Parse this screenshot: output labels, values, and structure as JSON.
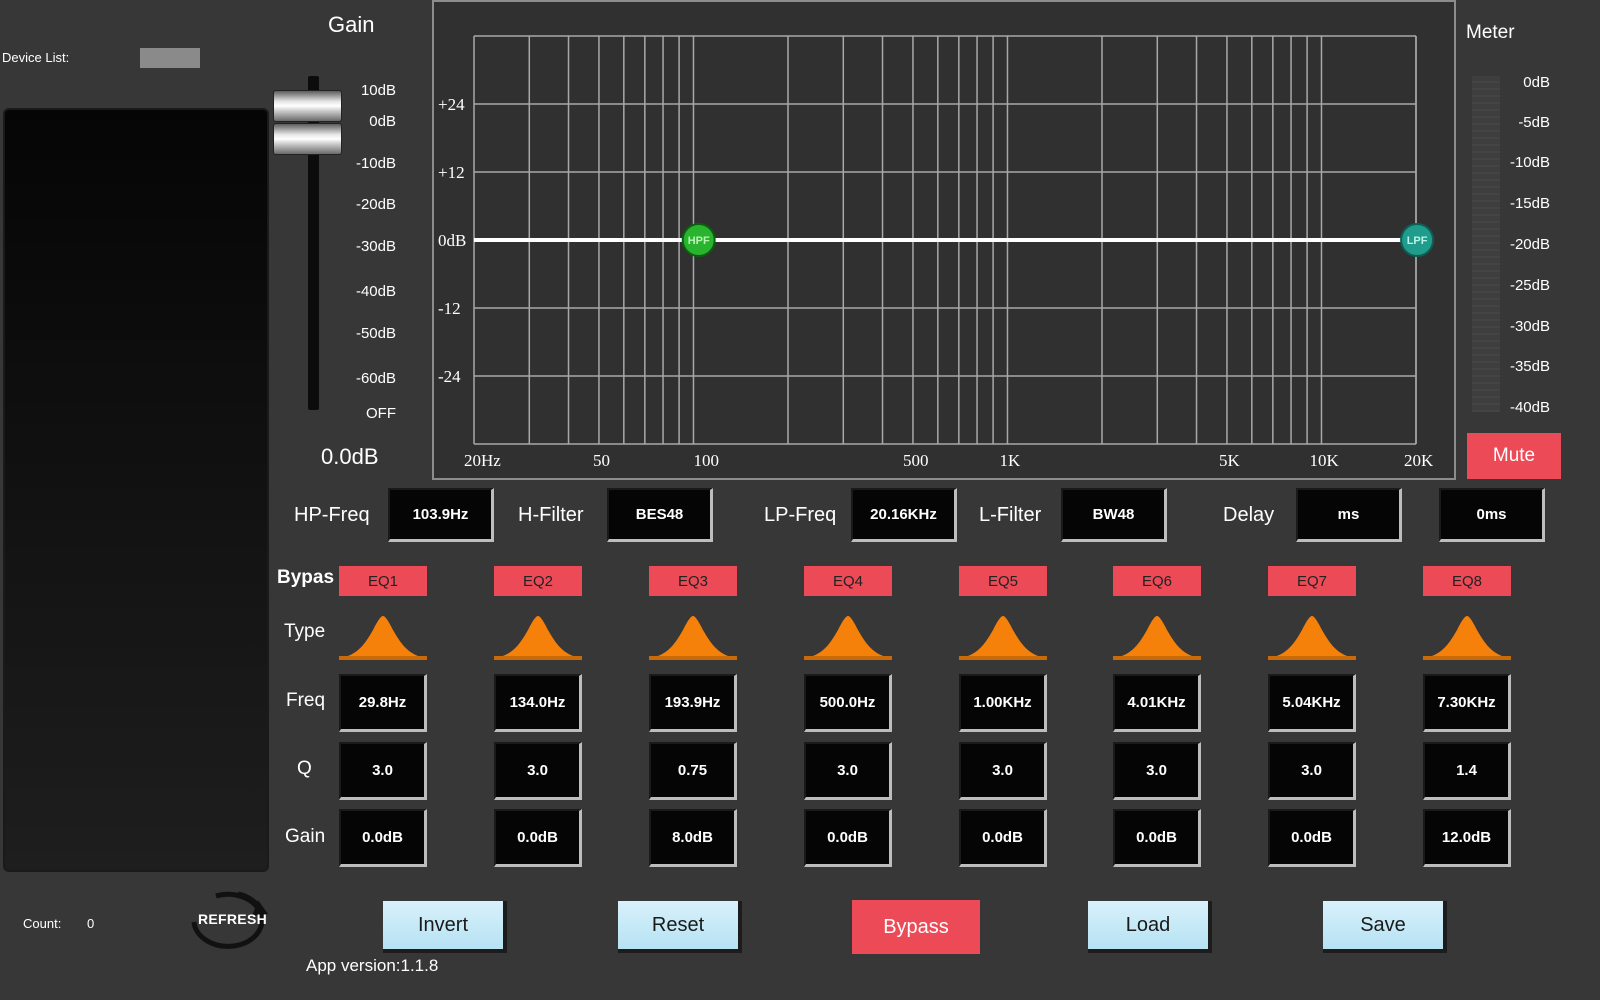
{
  "device_panel": {
    "label": "Device List:",
    "count_label": "Count:",
    "count_value": "0",
    "refresh_label": "REFRESH"
  },
  "gain": {
    "title": "Gain",
    "scale": [
      "10dB",
      "0dB",
      "-10dB",
      "-20dB",
      "-30dB",
      "-40dB",
      "-50dB",
      "-60dB",
      "OFF"
    ],
    "readout": "0.0dB"
  },
  "graph": {
    "y_labels": [
      "+24",
      "+12",
      "0dB",
      "-12",
      "-24"
    ],
    "x_labels": [
      "20Hz",
      "50",
      "100",
      "500",
      "1K",
      "5K",
      "10K",
      "20K"
    ],
    "hpf_label": "HPF",
    "lpf_label": "LPF",
    "hpf_freq_hz": 103.9,
    "lpf_freq_hz": 20160,
    "response_db": 0,
    "colors": {
      "curve": "#ffffff",
      "grid": "#a8a8a8",
      "handle_fill": "#29b32e",
      "handle_text": "#b6f5b0"
    }
  },
  "meter": {
    "title": "Meter",
    "scale": [
      "0dB",
      "-5dB",
      "-10dB",
      "-15dB",
      "-20dB",
      "-25dB",
      "-30dB",
      "-35dB",
      "-40dB"
    ],
    "mute_label": "Mute"
  },
  "filters": {
    "hp_freq_label": "HP-Freq",
    "hp_freq_value": "103.9Hz",
    "h_filter_label": "H-Filter",
    "h_filter_value": "BES48",
    "lp_freq_label": "LP-Freq",
    "lp_freq_value": "20.16KHz",
    "l_filter_label": "L-Filter",
    "l_filter_value": "BW48",
    "delay_label": "Delay",
    "delay_unit": "ms",
    "delay_value": "0ms"
  },
  "eq_rows": {
    "bypass": "Bypas",
    "type": "Type",
    "freq": "Freq",
    "q": "Q",
    "gain": "Gain"
  },
  "eq_bands": [
    {
      "name": "EQ1",
      "type_icon": "peak-filter-icon",
      "freq": "29.8Hz",
      "q": "3.0",
      "gain": "0.0dB"
    },
    {
      "name": "EQ2",
      "type_icon": "peak-filter-icon",
      "freq": "134.0Hz",
      "q": "3.0",
      "gain": "0.0dB"
    },
    {
      "name": "EQ3",
      "type_icon": "peak-filter-icon",
      "freq": "193.9Hz",
      "q": "0.75",
      "gain": "8.0dB"
    },
    {
      "name": "EQ4",
      "type_icon": "peak-filter-icon",
      "freq": "500.0Hz",
      "q": "3.0",
      "gain": "0.0dB"
    },
    {
      "name": "EQ5",
      "type_icon": "peak-filter-icon",
      "freq": "1.00KHz",
      "q": "3.0",
      "gain": "0.0dB"
    },
    {
      "name": "EQ6",
      "type_icon": "peak-filter-icon",
      "freq": "4.01KHz",
      "q": "3.0",
      "gain": "0.0dB"
    },
    {
      "name": "EQ7",
      "type_icon": "peak-filter-icon",
      "freq": "5.04KHz",
      "q": "3.0",
      "gain": "0.0dB"
    },
    {
      "name": "EQ8",
      "type_icon": "peak-filter-icon",
      "freq": "7.30KHz",
      "q": "1.4",
      "gain": "12.0dB"
    }
  ],
  "actions": {
    "invert": "Invert",
    "reset": "Reset",
    "bypass": "Bypass",
    "load": "Load",
    "save": "Save"
  },
  "app_version": "App version:1.1.8",
  "colors": {
    "accent_red": "#ec4a56",
    "button_blue": "#c9ebf8",
    "peak_orange": "#f5800a",
    "background": "#373737"
  }
}
